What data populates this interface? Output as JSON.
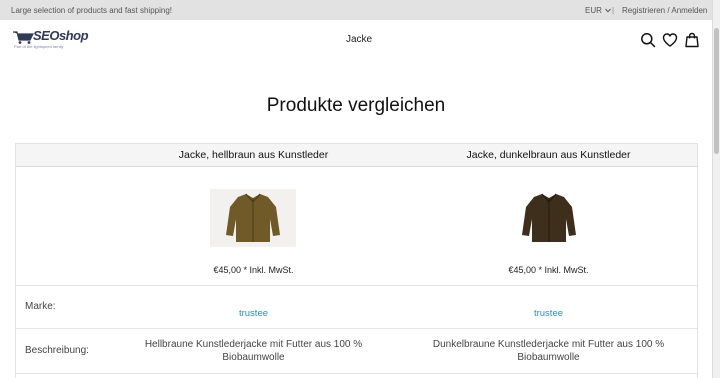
{
  "topbar": {
    "message": "Large selection of products and fast shipping!",
    "currency": "EUR",
    "separator": "|",
    "account": "Registrieren / Anmelden"
  },
  "header": {
    "logo_text": "SEOshop",
    "logo_tagline": "Part of the lightspeed family",
    "nav_item": "Jacke"
  },
  "page": {
    "title": "Produkte vergleichen"
  },
  "compare": {
    "products": [
      {
        "name": "Jacke, hellbraun aus Kunstleder",
        "price": "€45,00 * Inkl. MwSt.",
        "brand": "trustee",
        "description_line1": "Hellbraune Kunstlederjacke mit Futter aus 100 %",
        "description_line2": "Biobaumwolle"
      },
      {
        "name": "Jacke, dunkelbraun aus Kunstleder",
        "price": "€45,00 * Inkl. MwSt.",
        "brand": "trustee",
        "description_line1": "Dunkelbraune Kunstlederjacke mit Futter aus 100 %",
        "description_line2": "Biobaumwolle"
      }
    ],
    "labels": {
      "brand": "Marke:",
      "description": "Beschreibung:"
    }
  },
  "colors": {
    "topbar_bg": "#e2e2e2",
    "link": "#2a8fc9",
    "logo": "#2f3b59"
  }
}
